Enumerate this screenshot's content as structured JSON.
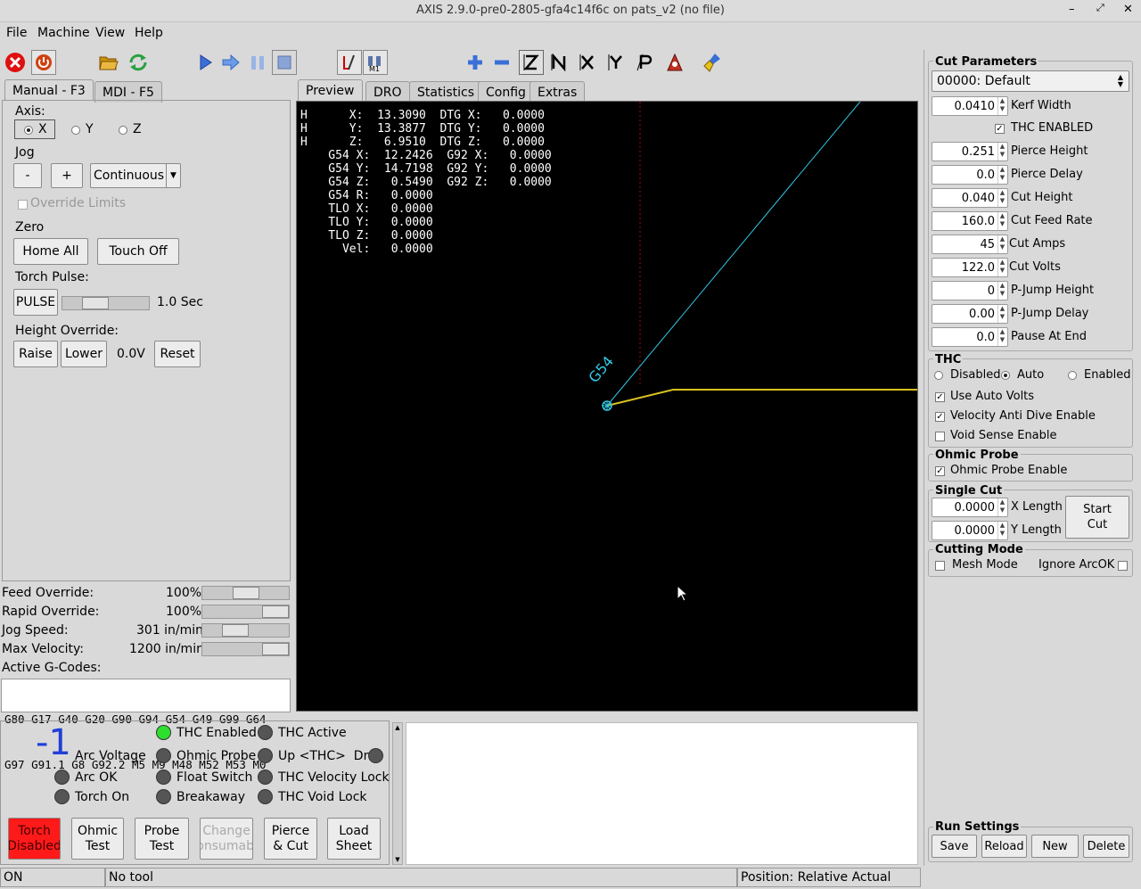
{
  "window": {
    "title": "AXIS 2.9.0-pre0-2805-gfa4c14f6c on pats_v2 (no file)"
  },
  "menu": [
    "File",
    "Machine",
    "View",
    "Help"
  ],
  "left_tabs": [
    "Manual - F3",
    "MDI - F5"
  ],
  "manual": {
    "axis_label": "Axis:",
    "axes": [
      "X",
      "Y",
      "Z"
    ],
    "jog_label": "Jog",
    "jog_minus": "-",
    "jog_plus": "+",
    "jog_mode": "Continuous",
    "override_limits": "Override Limits",
    "zero_label": "Zero",
    "home_all": "Home All",
    "touch_off": "Touch Off",
    "torch_pulse_label": "Torch Pulse:",
    "pulse": "PULSE",
    "pulse_time": "1.0 Sec",
    "height_override_label": "Height Override:",
    "raise": "Raise",
    "lower": "Lower",
    "height_value": "0.0V",
    "reset": "Reset"
  },
  "overrides": {
    "feed_label": "Feed Override:",
    "feed_value": "100%",
    "feed_level": 1.0,
    "rapid_label": "Rapid Override:",
    "rapid_value": "100%",
    "rapid_level": 1.0,
    "jog_label": "Jog Speed:",
    "jog_value": "301 in/min",
    "max_vel_label": "Max Velocity:",
    "max_vel_value": "1200 in/min",
    "active_gcodes_label": "Active G-Codes:",
    "gcodes_line1": "G80 G17 G40 G20 G90 G94 G54 G49 G99 G64",
    "gcodes_line2": "G97 G91.1 G8 G92.2 M5 M9 M48 M52 M53 M0"
  },
  "preview_tabs": [
    "Preview",
    "DRO",
    "Statistics",
    "Config",
    "Extras"
  ],
  "dro": {
    "lines": [
      "H      X:  13.3090  DTG X:   0.0000",
      "H      Y:  13.3877  DTG Y:   0.0000",
      "H      Z:   6.9510  DTG Z:   0.0000",
      "    G54 X:  12.2426  G92 X:   0.0000",
      "    G54 Y:  14.7198  G92 Y:   0.0000",
      "    G54 Z:   0.5490  G92 Z:   0.0000",
      "    G54 R:   0.0000",
      "    TLO X:   0.0000",
      "    TLO Y:   0.0000",
      "    TLO Z:   0.0000",
      "      Vel:   0.0000"
    ],
    "origin_label": "G54"
  },
  "cut_params": {
    "title": "Cut Parameters",
    "material": "00000: Default",
    "fields": [
      {
        "value": "0.0410",
        "label": "Kerf Width"
      },
      {
        "value": "0.251",
        "label": "Pierce Height"
      },
      {
        "value": "0.0",
        "label": "Pierce Delay"
      },
      {
        "value": "0.040",
        "label": "Cut Height"
      },
      {
        "value": "160.0",
        "label": "Cut Feed Rate"
      },
      {
        "value": "45",
        "label": "Cut Amps"
      },
      {
        "value": "122.0",
        "label": "Cut Volts"
      },
      {
        "value": "0",
        "label": "P-Jump Height"
      },
      {
        "value": "0.00",
        "label": "P-Jump Delay"
      },
      {
        "value": "0.0",
        "label": "Pause At End"
      }
    ],
    "thc_enabled": "THC ENABLED"
  },
  "thc": {
    "title": "THC",
    "disabled": "Disabled",
    "auto": "Auto",
    "enabled": "Enabled",
    "use_auto_volts": "Use Auto Volts",
    "vel_anti_dive": "Velocity Anti Dive Enable",
    "void_sense": "Void Sense Enable"
  },
  "ohmic": {
    "title": "Ohmic Probe",
    "enable": "Ohmic Probe Enable"
  },
  "single_cut": {
    "title": "Single Cut",
    "x_value": "0.0000",
    "x_label": "X Length",
    "y_value": "0.0000",
    "y_label": "Y Length",
    "start": "Start Cut"
  },
  "cutting_mode": {
    "title": "Cutting Mode",
    "mesh": "Mesh Mode",
    "ignore_arcok": "Ignore ArcOK"
  },
  "run_settings": {
    "title": "Run Settings",
    "save": "Save",
    "reload": "Reload",
    "new": "New",
    "delete": "Delete"
  },
  "plasma": {
    "arc_voltage_value": "-1",
    "arc_voltage": "Arc Voltage",
    "arc_ok": "Arc OK",
    "torch_on": "Torch On",
    "thc_enabled": "THC Enabled",
    "ohmic_probe": "Ohmic Probe",
    "float_switch": "Float Switch",
    "breakaway": "Breakaway",
    "thc_active": "THC Active",
    "up_thc_dn": "Up <THC>  Dn",
    "thc_vel_lock": "THC Velocity Lock",
    "thc_void_lock": "THC Void Lock"
  },
  "bottom_buttons": {
    "torch": "Torch Disabled",
    "ohmic_test": "Ohmic Test",
    "probe_test": "Probe Test",
    "change_consumable": "Change Consumable",
    "pierce_cut": "Pierce & Cut",
    "load_sheet": "Load Sheet"
  },
  "statusbar": {
    "state": "ON",
    "tool": "No tool",
    "position": "Position: Relative Actual"
  },
  "colors": {
    "torch_red": "#ff1a1a",
    "led_green": "#2ee02e",
    "arc_blue": "#1f3fd6",
    "path_cyan": "#32c8e6",
    "path_yellow": "#d8c020",
    "limit_red": "#c00000"
  }
}
